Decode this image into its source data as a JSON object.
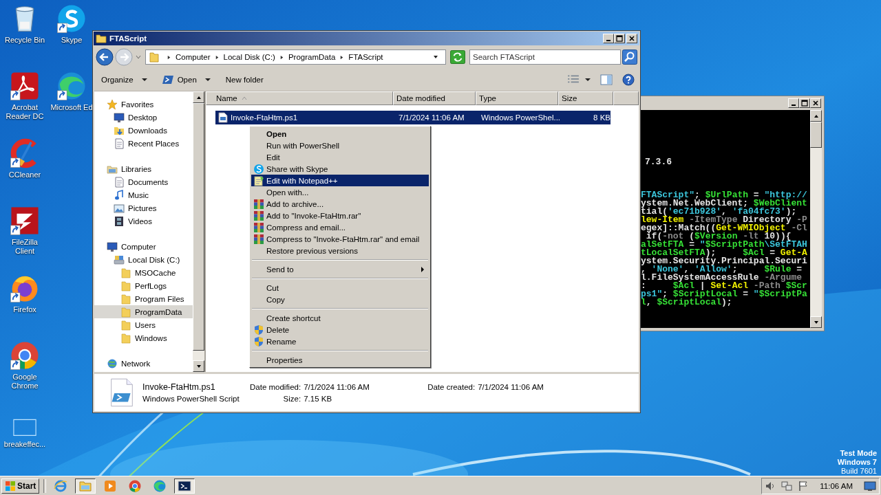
{
  "desktop_icons": [
    {
      "label": "Recycle Bin",
      "kind": "recycle",
      "shortcut": false
    },
    {
      "label": "Acrobat Reader DC",
      "kind": "acrobat",
      "shortcut": true
    },
    {
      "label": "CCleaner",
      "kind": "ccleaner",
      "shortcut": true
    },
    {
      "label": "FileZilla Client",
      "kind": "filezilla",
      "shortcut": true
    },
    {
      "label": "Firefox",
      "kind": "firefox",
      "shortcut": true
    },
    {
      "label": "Google Chrome",
      "kind": "chrome",
      "shortcut": true
    },
    {
      "label": "breakeffec...",
      "kind": "blank",
      "shortcut": false
    },
    {
      "label": "Skype",
      "kind": "skype",
      "shortcut": true
    },
    {
      "label": "Microsoft Ed",
      "kind": "edge",
      "shortcut": true
    }
  ],
  "explorer": {
    "title": "FTAScript",
    "breadcrumb": [
      "Computer",
      "Local Disk (C:)",
      "ProgramData",
      "FTAScript"
    ],
    "search": {
      "placeholder": "Search FTAScript"
    },
    "toolbar": [
      {
        "label": "Organize",
        "kind": "menu"
      },
      {
        "label": "Open",
        "kind": "open"
      },
      {
        "label": "New folder",
        "kind": "plain"
      }
    ],
    "navigation": [
      {
        "label": "Favorites",
        "kind": "star",
        "selected": false,
        "children": [
          {
            "label": "Desktop",
            "kind": "monitor",
            "selected": false
          },
          {
            "label": "Downloads",
            "kind": "downloads",
            "selected": false
          },
          {
            "label": "Recent Places",
            "kind": "document",
            "selected": false
          }
        ]
      },
      {
        "label": "Libraries",
        "kind": "library",
        "selected": false,
        "children": [
          {
            "label": "Documents",
            "kind": "document",
            "selected": false
          },
          {
            "label": "Music",
            "kind": "music",
            "selected": false
          },
          {
            "label": "Pictures",
            "kind": "picture",
            "selected": false
          },
          {
            "label": "Videos",
            "kind": "film",
            "selected": false
          }
        ]
      },
      {
        "label": "Computer",
        "kind": "monitor",
        "selected": false,
        "children": [
          {
            "label": "Local Disk (C:)",
            "kind": "disk",
            "selected": false,
            "children": [
              {
                "label": "MSOCache",
                "kind": "folder",
                "selected": false
              },
              {
                "label": "PerfLogs",
                "kind": "folder",
                "selected": false
              },
              {
                "label": "Program Files",
                "kind": "folder",
                "selected": false
              },
              {
                "label": "ProgramData",
                "kind": "folder",
                "selected": true
              },
              {
                "label": "Users",
                "kind": "folder",
                "selected": false
              },
              {
                "label": "Windows",
                "kind": "folder",
                "selected": false
              }
            ]
          }
        ]
      },
      {
        "label": "Network",
        "kind": "globe",
        "selected": false
      }
    ],
    "columns": [
      {
        "label": "Name",
        "sorted": true
      },
      {
        "label": "Date modified",
        "sorted": false
      },
      {
        "label": "Type",
        "sorted": false
      },
      {
        "label": "Size",
        "sorted": false
      }
    ],
    "files": [
      {
        "name": "Invoke-FtaHtm.ps1",
        "date_modified": "7/1/2024 11:06 AM",
        "type": "Windows PowerShel...",
        "size": "8 KB",
        "selected": true
      }
    ],
    "details": {
      "name": "Invoke-FtaHtm.ps1",
      "type": "Windows PowerShell Script",
      "fields": [
        {
          "label": "Date modified:",
          "value": "7/1/2024 11:06 AM"
        },
        {
          "label": "Date created:",
          "value": "7/1/2024 11:06 AM"
        },
        {
          "label": "Size:",
          "value": "7.15 KB"
        }
      ]
    }
  },
  "context_menu": [
    {
      "label": "Open",
      "kind": "default",
      "selected": false
    },
    {
      "label": "Run with PowerShell",
      "kind": "plain",
      "selected": false
    },
    {
      "label": "Edit",
      "kind": "plain",
      "selected": false
    },
    {
      "label": "Share with Skype",
      "kind": "skype",
      "selected": false
    },
    {
      "label": "Edit with Notepad++",
      "kind": "notepad",
      "selected": true
    },
    {
      "label": "Open with...",
      "kind": "plain",
      "selected": false
    },
    {
      "label": "Add to archive...",
      "kind": "archive",
      "selected": false
    },
    {
      "label": "Add to \"Invoke-FtaHtm.rar\"",
      "kind": "archive",
      "selected": false
    },
    {
      "label": "Compress and email...",
      "kind": "archive",
      "selected": false
    },
    {
      "label": "Compress to \"Invoke-FtaHtm.rar\" and email",
      "kind": "archive",
      "selected": false
    },
    {
      "label": "Restore previous versions",
      "kind": "plain",
      "selected": false
    },
    {
      "kind": "separator"
    },
    {
      "label": "Send to",
      "kind": "submenu",
      "selected": false
    },
    {
      "kind": "separator"
    },
    {
      "label": "Cut",
      "kind": "plain",
      "selected": false
    },
    {
      "label": "Copy",
      "kind": "plain",
      "selected": false
    },
    {
      "kind": "separator"
    },
    {
      "label": "Create shortcut",
      "kind": "plain",
      "selected": false
    },
    {
      "label": "Delete",
      "kind": "shield",
      "selected": false
    },
    {
      "label": "Rename",
      "kind": "shield",
      "selected": false
    },
    {
      "kind": "separator"
    },
    {
      "label": "Properties",
      "kind": "plain",
      "selected": false
    }
  ],
  "console": {
    "lines": [
      [
        {
          "text": "7.3.6",
          "kind": "plain"
        }
      ],
      [
        {
          "text": "FTAScript\"",
          "kind": "string"
        },
        {
          "text": "; ",
          "kind": "plain"
        },
        {
          "text": "$UrlPath",
          "kind": "variable"
        },
        {
          "text": " = ",
          "kind": "plain"
        },
        {
          "text": "\"http://",
          "kind": "string"
        }
      ],
      [
        {
          "text": "ystem.Net.WebClient; ",
          "kind": "plain"
        },
        {
          "text": "$WebClient",
          "kind": "variable"
        }
      ],
      [
        {
          "text": "tial(",
          "kind": "plain"
        },
        {
          "text": "'ec71b928'",
          "kind": "string"
        },
        {
          "text": ", ",
          "kind": "plain"
        },
        {
          "text": "'fa04fc73'",
          "kind": "string"
        },
        {
          "text": ");",
          "kind": "plain"
        }
      ],
      [
        {
          "text": "lew-Item",
          "kind": "cmdlet"
        },
        {
          "text": " -ItemType",
          "kind": "param"
        },
        {
          "text": " Directory",
          "kind": "plain"
        },
        {
          "text": " -P",
          "kind": "param"
        }
      ],
      [
        {
          "text": "egex]::Match((",
          "kind": "plain"
        },
        {
          "text": "Get-WMIObject",
          "kind": "cmdlet"
        },
        {
          "text": " -Cl",
          "kind": "param"
        }
      ],
      [
        {
          "text": " if(",
          "kind": "plain"
        },
        {
          "text": "-not",
          "kind": "param"
        },
        {
          "text": " (",
          "kind": "plain"
        },
        {
          "text": "$Version",
          "kind": "variable"
        },
        {
          "text": " -lt",
          "kind": "param"
        },
        {
          "text": " 10)){",
          "kind": "plain"
        }
      ],
      [
        {
          "text": "alSetFTA",
          "kind": "variable"
        },
        {
          "text": " = ",
          "kind": "plain"
        },
        {
          "text": "\"",
          "kind": "string"
        },
        {
          "text": "$ScriptPath",
          "kind": "variable"
        },
        {
          "text": "\\SetFTAH",
          "kind": "string"
        }
      ],
      [
        {
          "text": "tLocalSetFTA",
          "kind": "variable"
        },
        {
          "text": ");     ",
          "kind": "plain"
        },
        {
          "text": "$Acl",
          "kind": "variable"
        },
        {
          "text": " = ",
          "kind": "plain"
        },
        {
          "text": "Get-A",
          "kind": "cmdlet"
        }
      ],
      [
        {
          "text": "ystem.Security.Principal.Securi",
          "kind": "plain"
        }
      ],
      [
        {
          "text": ", ",
          "kind": "plain"
        },
        {
          "text": "'None'",
          "kind": "string"
        },
        {
          "text": ", ",
          "kind": "plain"
        },
        {
          "text": "'Allow'",
          "kind": "string"
        },
        {
          "text": ";     ",
          "kind": "plain"
        },
        {
          "text": "$Rule",
          "kind": "variable"
        },
        {
          "text": " =",
          "kind": "plain"
        }
      ],
      [
        {
          "text": "l.FileSystemAccessRule",
          "kind": "plain"
        },
        {
          "text": " -Argume",
          "kind": "param"
        }
      ],
      [
        {
          "text": ":     ",
          "kind": "plain"
        },
        {
          "text": "$Acl",
          "kind": "variable"
        },
        {
          "text": " | ",
          "kind": "plain"
        },
        {
          "text": "Set-Acl",
          "kind": "cmdlet"
        },
        {
          "text": " -Path ",
          "kind": "param"
        },
        {
          "text": "$Scr",
          "kind": "variable"
        }
      ],
      [
        {
          "text": "ps1\"",
          "kind": "string"
        },
        {
          "text": "; ",
          "kind": "plain"
        },
        {
          "text": "$ScriptLocal",
          "kind": "variable"
        },
        {
          "text": " = ",
          "kind": "plain"
        },
        {
          "text": "\"",
          "kind": "string"
        },
        {
          "text": "$ScriptPa",
          "kind": "variable"
        }
      ],
      [
        {
          "text": "l",
          "kind": "variable"
        },
        {
          "text": ", ",
          "kind": "plain"
        },
        {
          "text": "$ScriptLocal",
          "kind": "variable"
        },
        {
          "text": ");",
          "kind": "plain"
        }
      ]
    ]
  },
  "system_notice": [
    {
      "text": "Test Mode",
      "bold": true
    },
    {
      "text": "Windows 7",
      "bold": true
    },
    {
      "text": "Build 7601",
      "bold": false
    }
  ],
  "taskbar": {
    "start": "Start",
    "apps": [
      {
        "kind": "ie",
        "active": false
      },
      {
        "kind": "explorer",
        "active": true
      },
      {
        "kind": "media",
        "active": false
      },
      {
        "kind": "chrome",
        "active": false
      },
      {
        "kind": "edge",
        "active": false
      },
      {
        "kind": "powershell",
        "active": true
      }
    ],
    "clock": "11:06 AM"
  }
}
